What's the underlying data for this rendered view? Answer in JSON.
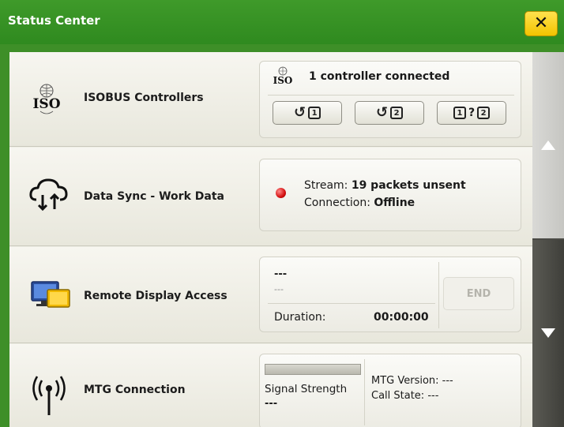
{
  "header": {
    "title": "Status Center",
    "close_label": "✕"
  },
  "isobus": {
    "label": "ISOBUS Controllers",
    "icon_text": "ISO",
    "status_text": "1 controller connected",
    "buttons": [
      {
        "icon": "undo-icon",
        "num": "1"
      },
      {
        "icon": "undo-icon",
        "num": "2"
      },
      {
        "num_a": "1",
        "mid": "?",
        "num_b": "2"
      }
    ]
  },
  "data_sync": {
    "label": "Data Sync - Work Data",
    "stream_label": "Stream: ",
    "stream_value": "19 packets unsent",
    "connection_label": "Connection: ",
    "connection_value": "Offline",
    "indicator_color": "#d41010"
  },
  "remote": {
    "label": "Remote Display Access",
    "line1": "---",
    "line2": "---",
    "duration_label": "Duration:",
    "duration_value": "00:00:00",
    "end_label": "END"
  },
  "mtg": {
    "label": "MTG Connection",
    "signal_label": "Signal Strength",
    "signal_value": "---",
    "version_text": "MTG Version: ---",
    "call_state_text": "Call State: ---"
  },
  "colors": {
    "header_green": "#3a9527",
    "accent_yellow": "#f5cc0a"
  }
}
